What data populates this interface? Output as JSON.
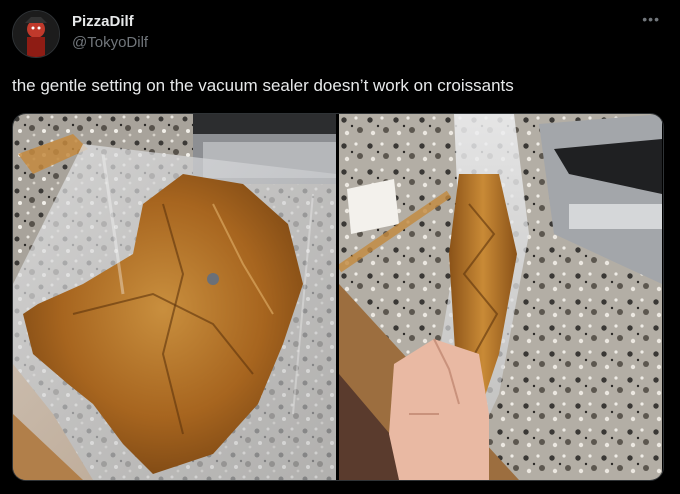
{
  "tweet": {
    "author": {
      "display_name": "PizzaDilf",
      "handle": "@TokyoDilf",
      "avatar_icon": "avatar-image"
    },
    "more_icon": "ellipsis-icon",
    "text": "the gentle setting on the vacuum sealer doesn’t work on croissants",
    "media": {
      "photos": [
        {
          "subject": "flattened croissant in vacuum bag on granite counter"
        },
        {
          "subject": "hand holding vacuum bag with squashed croissant next to vacuum sealer"
        }
      ]
    }
  },
  "colors": {
    "background": "#000000",
    "text_primary": "#e7e9ea",
    "text_secondary": "#71767b",
    "border": "#2f3336"
  }
}
